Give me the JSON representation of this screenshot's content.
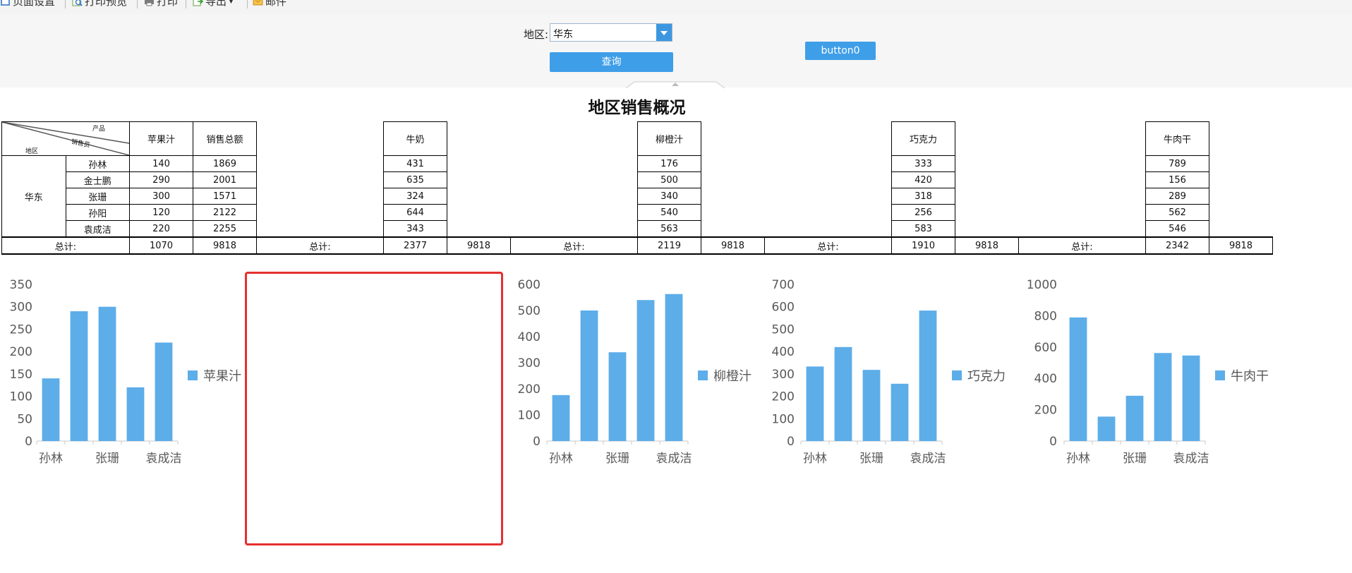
{
  "toolbar": {
    "items": [
      {
        "label": "页面设置",
        "icon": "page-setup-icon"
      },
      {
        "label": "打印预览",
        "icon": "print-preview-icon"
      },
      {
        "label": "打印",
        "icon": "printer-icon"
      },
      {
        "label": "导出",
        "icon": "export-icon"
      },
      {
        "label": "邮件",
        "icon": "mail-icon"
      }
    ]
  },
  "params": {
    "region_label": "地区:",
    "region_value": "华东",
    "query_button": "查询",
    "button0": "button0"
  },
  "report": {
    "title": "地区销售概况",
    "corner": {
      "product": "产品",
      "salesperson": "销售员",
      "region": "地区"
    },
    "region": "华东",
    "total_label": "总计:",
    "products": [
      "苹果汁",
      "牛奶",
      "柳橙汁",
      "巧克力",
      "牛肉干"
    ],
    "sales_total_header": "销售总额",
    "salespeople": [
      "孙林",
      "金士鹏",
      "张珊",
      "孙阳",
      "袁成洁"
    ],
    "values": {
      "苹果汁": [
        140,
        290,
        300,
        120,
        220
      ],
      "牛奶": [
        431,
        635,
        324,
        644,
        343
      ],
      "柳橙汁": [
        176,
        500,
        340,
        540,
        563
      ],
      "巧克力": [
        333,
        420,
        318,
        256,
        583
      ],
      "牛肉干": [
        789,
        156,
        289,
        562,
        546
      ]
    },
    "sales_totals": [
      1869,
      2001,
      1571,
      2122,
      2255
    ],
    "totals": {
      "苹果汁": 1070,
      "牛奶": 2377,
      "柳橙汁": 2119,
      "巧克力": 1910,
      "牛肉干": 2342
    },
    "grand_total": 9818
  },
  "chart_data": [
    {
      "type": "bar",
      "categories": [
        "孙林",
        "金士鹏",
        "张珊",
        "孙阳",
        "袁成洁"
      ],
      "tick_labels": [
        "孙林",
        "张珊",
        "袁成洁"
      ],
      "series": [
        {
          "name": "苹果汁",
          "values": [
            140,
            290,
            300,
            120,
            220
          ]
        }
      ],
      "ylim": [
        0,
        350
      ],
      "yticks": [
        0,
        50,
        100,
        150,
        200,
        250,
        300,
        350
      ],
      "legend": "right",
      "color": "#5dade9"
    },
    {
      "type": "bar",
      "categories": [
        "孙林",
        "金士鹏",
        "张珊",
        "孙阳",
        "袁成洁"
      ],
      "tick_labels": [
        "孙林",
        "张珊",
        "袁成洁"
      ],
      "series": [
        {
          "name": "柳橙汁",
          "values": [
            176,
            500,
            340,
            540,
            563
          ]
        }
      ],
      "ylim": [
        0,
        600
      ],
      "yticks": [
        0,
        100,
        200,
        300,
        400,
        500,
        600
      ],
      "legend": "right",
      "color": "#5dade9"
    },
    {
      "type": "bar",
      "categories": [
        "孙林",
        "金士鹏",
        "张珊",
        "孙阳",
        "袁成洁"
      ],
      "tick_labels": [
        "孙林",
        "张珊",
        "袁成洁"
      ],
      "series": [
        {
          "name": "巧克力",
          "values": [
            333,
            420,
            318,
            256,
            583
          ]
        }
      ],
      "ylim": [
        0,
        700
      ],
      "yticks": [
        0,
        100,
        200,
        300,
        400,
        500,
        600,
        700
      ],
      "legend": "right",
      "color": "#5dade9"
    },
    {
      "type": "bar",
      "categories": [
        "孙林",
        "金士鹏",
        "张珊",
        "孙阳",
        "袁成洁"
      ],
      "tick_labels": [
        "孙林",
        "张珊",
        "袁成洁"
      ],
      "series": [
        {
          "name": "牛肉干",
          "values": [
            789,
            156,
            289,
            562,
            546
          ]
        }
      ],
      "ylim": [
        0,
        1000
      ],
      "yticks": [
        0,
        200,
        400,
        600,
        800,
        1000
      ],
      "legend": "right",
      "color": "#5dade9"
    }
  ]
}
